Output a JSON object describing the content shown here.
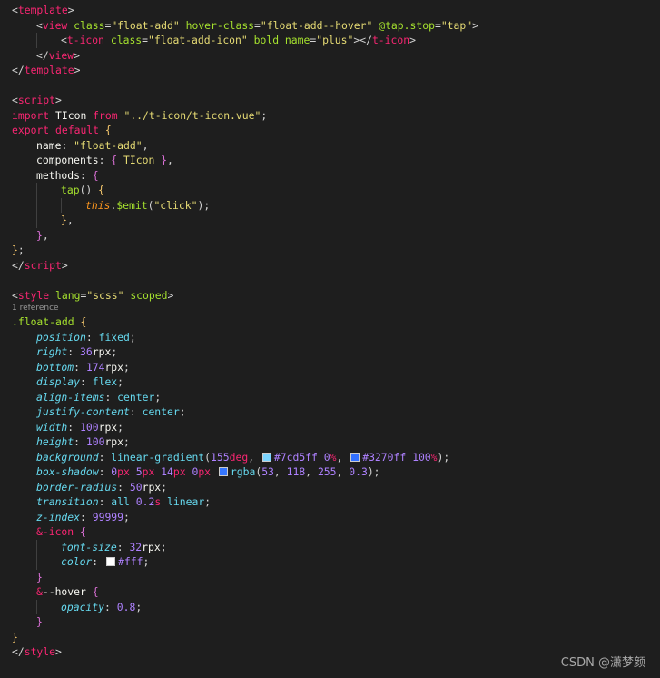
{
  "editor": {
    "language": "vue",
    "theme": {
      "background": "#1e1e1e",
      "tag": "#f92672",
      "attribute": "#a6e22e",
      "string": "#e6db74",
      "property": "#66d9ef",
      "number": "#ae81ff",
      "bracket": "#f0c36b"
    },
    "lines": [
      {
        "indent": 0,
        "tokens": [
          [
            "punc",
            "<"
          ],
          [
            "tag",
            "template"
          ],
          [
            "punc",
            ">"
          ]
        ]
      },
      {
        "indent": 1,
        "tokens": [
          [
            "punc",
            "<"
          ],
          [
            "tag",
            "view"
          ],
          [
            "punc",
            " "
          ],
          [
            "attr",
            "class"
          ],
          [
            "punc",
            "="
          ],
          [
            "str",
            "\"float-add\""
          ],
          [
            "punc",
            " "
          ],
          [
            "attr",
            "hover-class"
          ],
          [
            "punc",
            "="
          ],
          [
            "str",
            "\"float-add--hover\""
          ],
          [
            "punc",
            " "
          ],
          [
            "attr",
            "@tap.stop"
          ],
          [
            "punc",
            "="
          ],
          [
            "str",
            "\"tap\""
          ],
          [
            "punc",
            ">"
          ]
        ]
      },
      {
        "indent": 2,
        "tokens": [
          [
            "punc",
            "<"
          ],
          [
            "tag",
            "t-icon"
          ],
          [
            "punc",
            " "
          ],
          [
            "attr",
            "class"
          ],
          [
            "punc",
            "="
          ],
          [
            "str",
            "\"float-add-icon\""
          ],
          [
            "punc",
            " "
          ],
          [
            "attr",
            "bold"
          ],
          [
            "punc",
            " "
          ],
          [
            "attr",
            "name"
          ],
          [
            "punc",
            "="
          ],
          [
            "str",
            "\"plus\""
          ],
          [
            "punc",
            "></"
          ],
          [
            "tag",
            "t-icon"
          ],
          [
            "punc",
            ">"
          ]
        ]
      },
      {
        "indent": 1,
        "tokens": [
          [
            "punc",
            "</"
          ],
          [
            "tag",
            "view"
          ],
          [
            "punc",
            ">"
          ]
        ]
      },
      {
        "indent": 0,
        "tokens": [
          [
            "punc",
            "</"
          ],
          [
            "tag",
            "template"
          ],
          [
            "punc",
            ">"
          ]
        ]
      },
      {
        "indent": 0,
        "tokens": []
      },
      {
        "indent": 0,
        "tokens": [
          [
            "punc",
            "<"
          ],
          [
            "tag",
            "script"
          ],
          [
            "punc",
            ">"
          ]
        ]
      },
      {
        "indent": 0,
        "tokens": [
          [
            "kw",
            "import"
          ],
          [
            "plain",
            " TIcon "
          ],
          [
            "kw",
            "from"
          ],
          [
            "plain",
            " "
          ],
          [
            "str",
            "\"../t-icon/t-icon.vue\""
          ],
          [
            "punc",
            ";"
          ]
        ]
      },
      {
        "indent": 0,
        "tokens": [
          [
            "kw",
            "export"
          ],
          [
            "plain",
            " "
          ],
          [
            "kw",
            "default"
          ],
          [
            "plain",
            " "
          ],
          [
            "brace",
            "{"
          ]
        ]
      },
      {
        "indent": 1,
        "tokens": [
          [
            "plain",
            "name"
          ],
          [
            "punc",
            ": "
          ],
          [
            "str",
            "\"float-add\""
          ],
          [
            "punc",
            ","
          ]
        ]
      },
      {
        "indent": 1,
        "tokens": [
          [
            "plain",
            "components"
          ],
          [
            "punc",
            ": "
          ],
          [
            "brace2",
            "{"
          ],
          [
            "plain",
            " "
          ],
          [
            "comp",
            "TIcon"
          ],
          [
            "plain",
            " "
          ],
          [
            "brace2",
            "}"
          ],
          [
            "punc",
            ","
          ]
        ]
      },
      {
        "indent": 1,
        "tokens": [
          [
            "plain",
            "methods"
          ],
          [
            "punc",
            ": "
          ],
          [
            "brace2",
            "{"
          ]
        ]
      },
      {
        "indent": 2,
        "tokens": [
          [
            "fn",
            "tap"
          ],
          [
            "punc",
            "() "
          ],
          [
            "brace",
            "{"
          ]
        ]
      },
      {
        "indent": 3,
        "tokens": [
          [
            "this",
            "this"
          ],
          [
            "punc",
            "."
          ],
          [
            "fn",
            "$emit"
          ],
          [
            "punc",
            "("
          ],
          [
            "str",
            "\"click\""
          ],
          [
            "punc",
            ");"
          ]
        ]
      },
      {
        "indent": 2,
        "tokens": [
          [
            "brace",
            "}"
          ],
          [
            "punc",
            ","
          ]
        ]
      },
      {
        "indent": 1,
        "tokens": [
          [
            "brace2",
            "}"
          ],
          [
            "punc",
            ","
          ]
        ]
      },
      {
        "indent": 0,
        "tokens": [
          [
            "brace",
            "}"
          ],
          [
            "punc",
            ";"
          ]
        ]
      },
      {
        "indent": 0,
        "tokens": [
          [
            "punc",
            "</"
          ],
          [
            "tag",
            "script"
          ],
          [
            "punc",
            ">"
          ]
        ]
      },
      {
        "indent": 0,
        "tokens": []
      },
      {
        "indent": 0,
        "tokens": [
          [
            "punc",
            "<"
          ],
          [
            "tag",
            "style"
          ],
          [
            "punc",
            " "
          ],
          [
            "attr",
            "lang"
          ],
          [
            "punc",
            "="
          ],
          [
            "str",
            "\"scss\""
          ],
          [
            "punc",
            " "
          ],
          [
            "attr",
            "scoped"
          ],
          [
            "punc",
            ">"
          ]
        ]
      },
      {
        "indent": 0,
        "kind": "ref",
        "tokens": [
          [
            "ref",
            "1 reference"
          ]
        ]
      },
      {
        "indent": 0,
        "tokens": [
          [
            "sel",
            ".float-add"
          ],
          [
            "plain",
            " "
          ],
          [
            "brace",
            "{"
          ]
        ]
      },
      {
        "indent": 1,
        "tokens": [
          [
            "ital",
            "position"
          ],
          [
            "punc",
            ": "
          ],
          [
            "val",
            "fixed"
          ],
          [
            "punc",
            ";"
          ]
        ]
      },
      {
        "indent": 1,
        "tokens": [
          [
            "ital",
            "right"
          ],
          [
            "punc",
            ": "
          ],
          [
            "num",
            "36"
          ],
          [
            "plain",
            "rpx"
          ],
          [
            "punc",
            ";"
          ]
        ]
      },
      {
        "indent": 1,
        "tokens": [
          [
            "ital",
            "bottom"
          ],
          [
            "punc",
            ": "
          ],
          [
            "num",
            "174"
          ],
          [
            "plain",
            "rpx"
          ],
          [
            "punc",
            ";"
          ]
        ]
      },
      {
        "indent": 1,
        "tokens": [
          [
            "ital",
            "display"
          ],
          [
            "punc",
            ": "
          ],
          [
            "val",
            "flex"
          ],
          [
            "punc",
            ";"
          ]
        ]
      },
      {
        "indent": 1,
        "tokens": [
          [
            "ital",
            "align-items"
          ],
          [
            "punc",
            ": "
          ],
          [
            "val",
            "center"
          ],
          [
            "punc",
            ";"
          ]
        ]
      },
      {
        "indent": 1,
        "tokens": [
          [
            "ital",
            "justify-content"
          ],
          [
            "punc",
            ": "
          ],
          [
            "val",
            "center"
          ],
          [
            "punc",
            ";"
          ]
        ]
      },
      {
        "indent": 1,
        "tokens": [
          [
            "ital",
            "width"
          ],
          [
            "punc",
            ": "
          ],
          [
            "num",
            "100"
          ],
          [
            "plain",
            "rpx"
          ],
          [
            "punc",
            ";"
          ]
        ]
      },
      {
        "indent": 1,
        "tokens": [
          [
            "ital",
            "height"
          ],
          [
            "punc",
            ": "
          ],
          [
            "num",
            "100"
          ],
          [
            "plain",
            "rpx"
          ],
          [
            "punc",
            ";"
          ]
        ]
      },
      {
        "indent": 1,
        "tokens": [
          [
            "ital",
            "background"
          ],
          [
            "punc",
            ": "
          ],
          [
            "val",
            "linear-gradient"
          ],
          [
            "punc",
            "("
          ],
          [
            "num",
            "155"
          ],
          [
            "unit",
            "deg"
          ],
          [
            "punc",
            ", "
          ],
          [
            "swatch",
            "#7cd5ff"
          ],
          [
            "num",
            "#7cd5ff"
          ],
          [
            "plain",
            " "
          ],
          [
            "num",
            "0"
          ],
          [
            "unit",
            "%"
          ],
          [
            "punc",
            ", "
          ],
          [
            "swatch",
            "#3270ff"
          ],
          [
            "num",
            "#3270ff"
          ],
          [
            "plain",
            " "
          ],
          [
            "num",
            "100"
          ],
          [
            "unit",
            "%"
          ],
          [
            "punc",
            ");"
          ]
        ]
      },
      {
        "indent": 1,
        "tokens": [
          [
            "ital",
            "box-shadow"
          ],
          [
            "punc",
            ": "
          ],
          [
            "num",
            "0"
          ],
          [
            "unit",
            "px"
          ],
          [
            "plain",
            " "
          ],
          [
            "num",
            "5"
          ],
          [
            "unit",
            "px"
          ],
          [
            "plain",
            " "
          ],
          [
            "num",
            "14"
          ],
          [
            "unit",
            "px"
          ],
          [
            "plain",
            " "
          ],
          [
            "num",
            "0"
          ],
          [
            "unit",
            "px"
          ],
          [
            "plain",
            " "
          ],
          [
            "swatch",
            "#3576ff"
          ],
          [
            "val",
            "rgba"
          ],
          [
            "punc",
            "("
          ],
          [
            "num",
            "53"
          ],
          [
            "punc",
            ", "
          ],
          [
            "num",
            "118"
          ],
          [
            "punc",
            ", "
          ],
          [
            "num",
            "255"
          ],
          [
            "punc",
            ", "
          ],
          [
            "num",
            "0.3"
          ],
          [
            "punc",
            ");"
          ]
        ]
      },
      {
        "indent": 1,
        "tokens": [
          [
            "ital",
            "border-radius"
          ],
          [
            "punc",
            ": "
          ],
          [
            "num",
            "50"
          ],
          [
            "plain",
            "rpx"
          ],
          [
            "punc",
            ";"
          ]
        ]
      },
      {
        "indent": 1,
        "tokens": [
          [
            "ital",
            "transition"
          ],
          [
            "punc",
            ": "
          ],
          [
            "val",
            "all"
          ],
          [
            "plain",
            " "
          ],
          [
            "num",
            "0.2"
          ],
          [
            "unit",
            "s"
          ],
          [
            "plain",
            " "
          ],
          [
            "val",
            "linear"
          ],
          [
            "punc",
            ";"
          ]
        ]
      },
      {
        "indent": 1,
        "tokens": [
          [
            "ital",
            "z-index"
          ],
          [
            "punc",
            ": "
          ],
          [
            "num",
            "99999"
          ],
          [
            "punc",
            ";"
          ]
        ]
      },
      {
        "indent": 1,
        "tokens": [
          [
            "kw",
            "&-icon"
          ],
          [
            "plain",
            " "
          ],
          [
            "brace2",
            "{"
          ]
        ]
      },
      {
        "indent": 2,
        "tokens": [
          [
            "ital",
            "font-size"
          ],
          [
            "punc",
            ": "
          ],
          [
            "num",
            "32"
          ],
          [
            "plain",
            "rpx"
          ],
          [
            "punc",
            ";"
          ]
        ]
      },
      {
        "indent": 2,
        "tokens": [
          [
            "ital",
            "color"
          ],
          [
            "punc",
            ": "
          ],
          [
            "swatch",
            "#ffffff"
          ],
          [
            "num",
            "#fff"
          ],
          [
            "punc",
            ";"
          ]
        ]
      },
      {
        "indent": 1,
        "tokens": [
          [
            "brace2",
            "}"
          ]
        ]
      },
      {
        "indent": 1,
        "tokens": [
          [
            "kw",
            "&"
          ],
          [
            "plain",
            "--hover "
          ],
          [
            "brace2",
            "{"
          ]
        ]
      },
      {
        "indent": 2,
        "tokens": [
          [
            "ital",
            "opacity"
          ],
          [
            "punc",
            ": "
          ],
          [
            "num",
            "0.8"
          ],
          [
            "punc",
            ";"
          ]
        ]
      },
      {
        "indent": 1,
        "tokens": [
          [
            "brace2",
            "}"
          ]
        ]
      },
      {
        "indent": 0,
        "tokens": [
          [
            "brace",
            "}"
          ]
        ]
      },
      {
        "indent": 0,
        "tokens": [
          [
            "punc",
            "</"
          ],
          [
            "tag",
            "style"
          ],
          [
            "punc",
            ">"
          ]
        ]
      }
    ]
  },
  "watermark": "CSDN @潇梦颜"
}
